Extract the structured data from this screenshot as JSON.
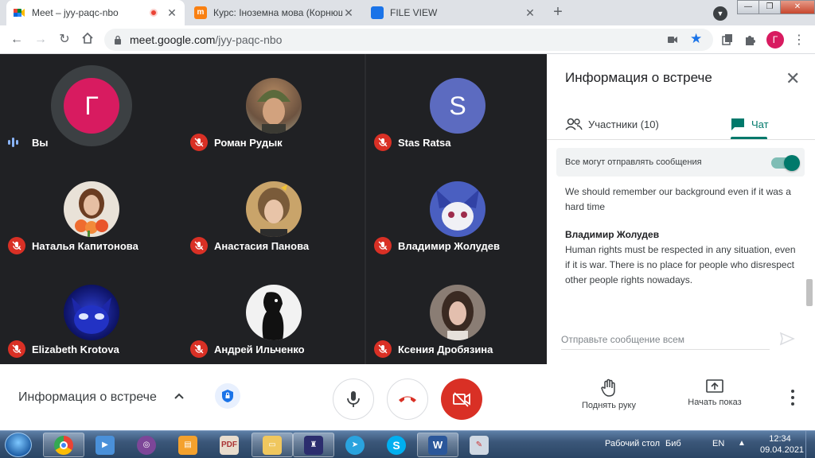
{
  "browser": {
    "tabs": [
      {
        "title": "Meet – jyy-paqc-nbo",
        "active": true,
        "recording": true
      },
      {
        "title": "Курс: Іноземна мова (Корнюш",
        "active": false
      },
      {
        "title": "FILE VIEW",
        "active": false
      }
    ],
    "new_tab": "+",
    "url_host": "meet.google.com",
    "url_path": "/jyy-paqc-nbo",
    "profile_initial": "Г"
  },
  "meet": {
    "participants": [
      {
        "name": "Вы",
        "initial": "Г",
        "color": "#d81b60",
        "muted": false,
        "speaking": true
      },
      {
        "name": "Роман Рудык",
        "muted": true
      },
      {
        "name": "Stas Ratsa",
        "initial": "S",
        "color": "#5c6bc0",
        "muted": true
      },
      {
        "name": "Наталья Капитонова",
        "muted": true
      },
      {
        "name": "Анастасия Панова",
        "muted": true
      },
      {
        "name": "Владимир Жолудев",
        "muted": true
      },
      {
        "name": "Elizabeth Krotova",
        "muted": true
      },
      {
        "name": "Андрей Ильченко",
        "muted": true
      },
      {
        "name": "Ксения Дробязина",
        "muted": true
      }
    ],
    "panel": {
      "title": "Информация о встрече",
      "tab_participants": "Участники (10)",
      "tab_chat": "Чат",
      "toggle_label": "Все могут отправлять сообщения",
      "toggle_on": true,
      "messages": [
        {
          "sender": "",
          "text": "We should remember our background even if it was a hard time"
        },
        {
          "sender": "Владимир Жолудев",
          "text": "Human rights must be respected in any situation, even if it is war. There is no place for people who disrespect other people rights nowadays."
        }
      ],
      "input_placeholder": "Отправьте сообщение всем"
    },
    "controls": {
      "meeting_info": "Информация о встрече",
      "raise_hand": "Поднять руку",
      "present": "Начать показ"
    }
  },
  "taskbar": {
    "desktop_label": "Рабочий стол",
    "library_label": "Биб",
    "lang": "EN",
    "time": "12:34",
    "date": "09.04.2021"
  }
}
